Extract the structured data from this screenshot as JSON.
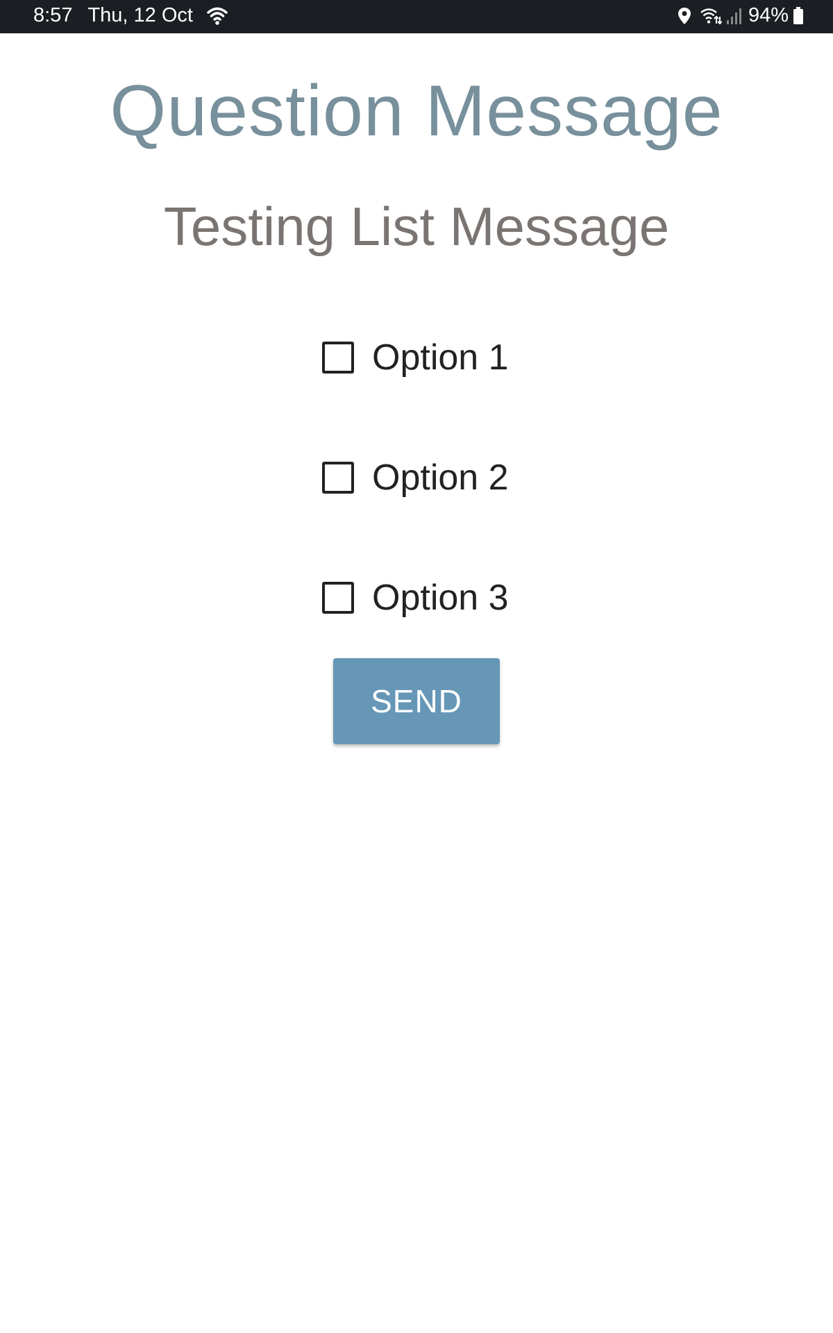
{
  "status_bar": {
    "time": "8:57",
    "date": "Thu, 12 Oct",
    "battery_percent": "94%",
    "icons": [
      "wifi-icon",
      "location-icon",
      "wifi-calling-icon",
      "signal-icon",
      "battery-icon"
    ]
  },
  "header": {
    "title": "Question Message",
    "subtitle": "Testing List Message"
  },
  "options": [
    {
      "label": "Option 1",
      "checked": false
    },
    {
      "label": "Option 2",
      "checked": false
    },
    {
      "label": "Option 3",
      "checked": false
    }
  ],
  "actions": {
    "send_label": "SEND"
  },
  "colors": {
    "title": "#78909c",
    "subtitle": "#7a7572",
    "button": "#6697b7",
    "status_bar": "#1b1e22"
  }
}
